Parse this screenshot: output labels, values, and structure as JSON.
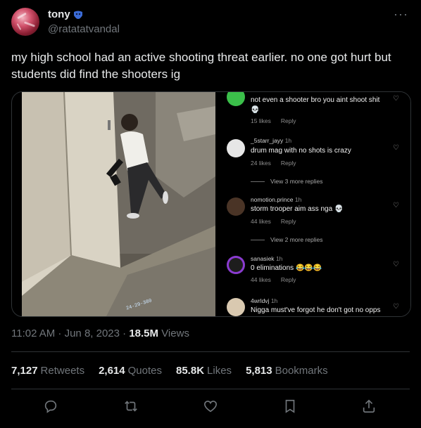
{
  "author": {
    "name": "tony",
    "handle": "@ratatatvandal",
    "verified_icon": "blue-mask-icon"
  },
  "tweet": {
    "text": "my high school had an active shooting threat earlier. no one got hurt but students did find the shooters ig",
    "time": "11:02 AM · Jun 8, 2023 · ",
    "views_count": "18.5M",
    "views_label": "Views"
  },
  "media": {
    "cctv_stamp": "24-29-380",
    "comments": [
      {
        "user": "",
        "time": "",
        "text": "not even a shooter bro you aint shoot shit",
        "emoji": "💀",
        "likes": "15 likes",
        "reply": "Reply"
      },
      {
        "user": "_5starr_jayy",
        "time": "1h",
        "text": "drum mag with no shots is crazy",
        "emoji": "",
        "likes": "24 likes",
        "reply": "Reply",
        "view_replies": "View 3 more replies"
      },
      {
        "user": "nomotion.prince",
        "time": "1h",
        "text": "storm trooper aim ass nga",
        "emoji": "💀",
        "likes": "44 likes",
        "reply": "Reply",
        "view_replies": "View 2 more replies"
      },
      {
        "user": "sanasiek",
        "time": "1h",
        "text": "0 eliminations",
        "emoji": "😂😂😂",
        "likes": "44 likes",
        "reply": "Reply"
      },
      {
        "user": "4wrldvj",
        "time": "1h",
        "text": "Nigga must've forgot he don't got no opps",
        "emoji": "",
        "likes": "",
        "reply": ""
      }
    ]
  },
  "stats": {
    "retweets_count": "7,127",
    "retweets_label": "Retweets",
    "quotes_count": "2,614",
    "quotes_label": "Quotes",
    "likes_count": "85.8K",
    "likes_label": "Likes",
    "bookmarks_count": "5,813",
    "bookmarks_label": "Bookmarks"
  },
  "actions": [
    "reply-icon",
    "retweet-icon",
    "like-icon",
    "bookmark-icon",
    "share-icon"
  ],
  "colors": {
    "background": "#000000",
    "text": "#e7e9ea",
    "muted": "#71767b",
    "divider": "#2f3336"
  }
}
